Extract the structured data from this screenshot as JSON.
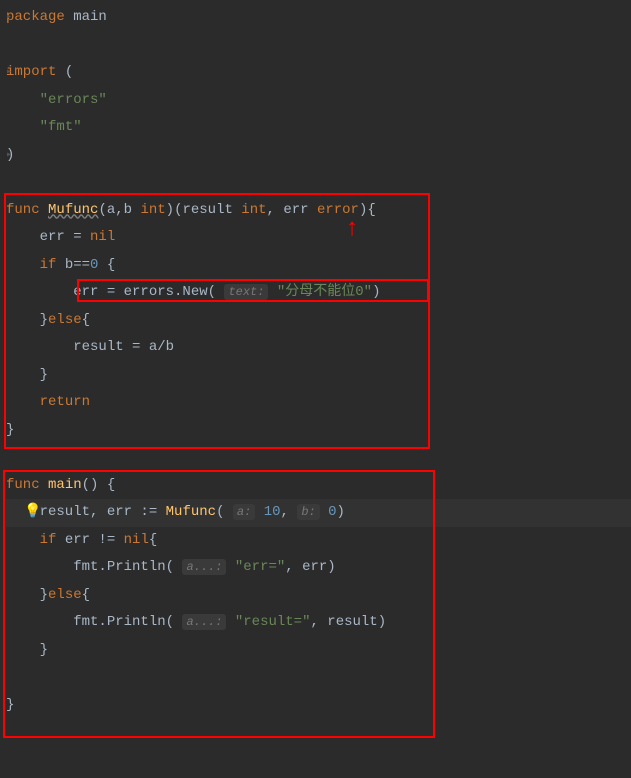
{
  "code": {
    "l1_package": "package",
    "l1_main": "main",
    "l3_import": "import",
    "l3_paren": "(",
    "l4_errors": "\"errors\"",
    "l5_fmt": "\"fmt\"",
    "l6_paren": ")",
    "l8_func": "func",
    "l8_name": "Mufunc",
    "l8_sig_open": "(a,b ",
    "l8_int1": "int",
    "l8_sig_mid": ")(result ",
    "l8_int2": "int",
    "l8_sep": ", err ",
    "l8_error": "error",
    "l8_close": "){",
    "l9": "    err = ",
    "l9_nil": "nil",
    "l10": "    ",
    "l10_if": "if",
    "l10_cond": " b==",
    "l10_zero": "0",
    "l10_brace": " {",
    "l11_indent": "        ",
    "l11_err": "err = errors.New(",
    "l11_hint": "text:",
    "l11_str": "\"分母不能位0\"",
    "l11_close": ")",
    "l12": "    }",
    "l12_else": "else",
    "l12_brace": "{",
    "l13": "        result = a/b",
    "l14": "    }",
    "l15": "    ",
    "l15_return": "return",
    "l16": "}",
    "l18_func": "func",
    "l18_main": "main",
    "l18_sig": "() {",
    "l19_indent": "    result, err := ",
    "l19_fn": "Mufunc",
    "l19_open": "(",
    "l19_hinta": "a:",
    "l19_a": "10",
    "l19_sep": ", ",
    "l19_hintb": "b:",
    "l19_b": "0",
    "l19_close": ")",
    "l20_indent": "    ",
    "l20_if": "if",
    "l20_cond": " err != ",
    "l20_nil": "nil",
    "l20_brace": "{",
    "l21_indent": "        fmt.Println(",
    "l21_hint": "a...:",
    "l21_str": "\"err=\"",
    "l21_rest": ", err)",
    "l22": "    }",
    "l22_else": "else",
    "l22_brace": "{",
    "l23_indent": "        fmt.Println(",
    "l23_hint": "a...:",
    "l23_str": "\"result=\"",
    "l23_rest": ", result)",
    "l24": "    }",
    "l26": "}"
  },
  "icons": {
    "bulb": "💡"
  }
}
